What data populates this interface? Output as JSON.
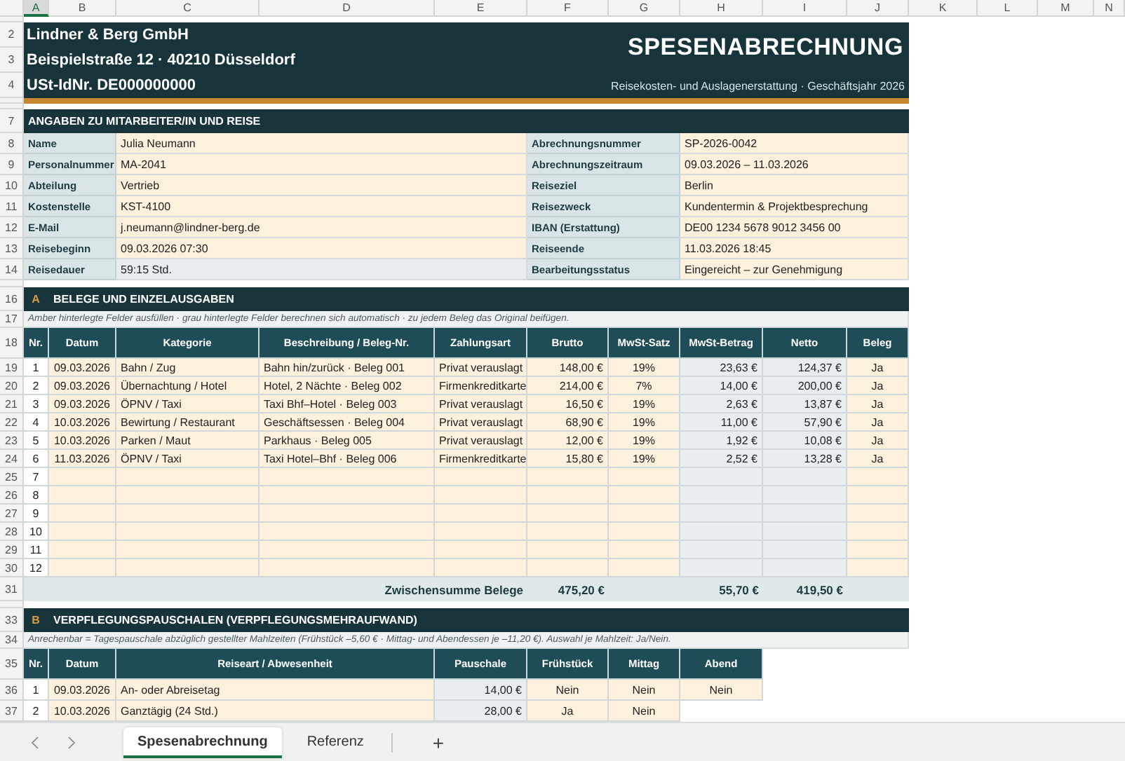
{
  "column_headers": [
    {
      "label": "A",
      "selected": true
    },
    {
      "label": "B",
      "selected": false
    },
    {
      "label": "C",
      "selected": false
    },
    {
      "label": "D",
      "selected": false
    },
    {
      "label": "E",
      "selected": false
    },
    {
      "label": "F",
      "selected": false
    },
    {
      "label": "G",
      "selected": false
    },
    {
      "label": "H",
      "selected": false
    },
    {
      "label": "I",
      "selected": false
    },
    {
      "label": "J",
      "selected": false
    },
    {
      "label": "K",
      "selected": false
    },
    {
      "label": "L",
      "selected": false
    },
    {
      "label": "M",
      "selected": false
    },
    {
      "label": "N",
      "selected": false
    }
  ],
  "row_numbers": [
    "2",
    "3",
    "4",
    "7",
    "8",
    "9",
    "10",
    "11",
    "12",
    "13",
    "14",
    "16",
    "17",
    "18",
    "19",
    "20",
    "21",
    "22",
    "23",
    "24",
    "25",
    "26",
    "27",
    "28",
    "29",
    "30",
    "31",
    "33",
    "34",
    "35",
    "36",
    "37"
  ],
  "header": {
    "company_lines": [
      "Lindner & Berg GmbH",
      "Beispielstraße 12 · 40210 Düsseldorf",
      "USt-IdNr. DE000000000"
    ],
    "title": "SPESENABRECHNUNG",
    "subtitle": "Reisekosten- und Auslagenerstattung  ·  Geschäftsjahr 2026"
  },
  "details": {
    "heading": "ANGABEN ZU MITARBEITER/IN UND REISE",
    "rows": [
      {
        "left": {
          "label": "Name",
          "value": "Julia Neumann",
          "kind": "input"
        },
        "right": {
          "label": "Abrechnungsnummer",
          "value": "SP-2026-0042",
          "kind": "input"
        }
      },
      {
        "left": {
          "label": "Personalnummer",
          "value": "MA-2041",
          "kind": "input"
        },
        "right": {
          "label": "Abrechnungszeitraum",
          "value": "09.03.2026 – 11.03.2026",
          "kind": "input"
        }
      },
      {
        "left": {
          "label": "Abteilung",
          "value": "Vertrieb",
          "kind": "input"
        },
        "right": {
          "label": "Reiseziel",
          "value": "Berlin",
          "kind": "input"
        }
      },
      {
        "left": {
          "label": "Kostenstelle",
          "value": "KST-4100",
          "kind": "input"
        },
        "right": {
          "label": "Reisezweck",
          "value": "Kundentermin & Projektbesprechung",
          "kind": "input"
        }
      },
      {
        "left": {
          "label": "E-Mail",
          "value": "j.neumann@lindner-berg.de",
          "kind": "input"
        },
        "right": {
          "label": "IBAN (Erstattung)",
          "value": "DE00 1234 5678 9012 3456 00",
          "kind": "input"
        }
      },
      {
        "left": {
          "label": "Reisebeginn",
          "value": "09.03.2026  07:30",
          "kind": "input"
        },
        "right": {
          "label": "Reiseende",
          "value": "11.03.2026  18:45",
          "kind": "input"
        }
      },
      {
        "left": {
          "label": "Reisedauer",
          "value": "59:15 Std.",
          "kind": "computed"
        },
        "right": {
          "label": "Bearbeitungsstatus",
          "value": "Eingereicht – zur Genehmigung",
          "kind": "input"
        }
      }
    ]
  },
  "receipts": {
    "letter": "A",
    "heading": "BELEGE UND EINZELAUSGABEN",
    "note": "Amber hinterlegte Felder ausfüllen · grau hinterlegte Felder berechnen sich automatisch · zu jedem Beleg das Original beifügen.",
    "columns": [
      {
        "label": "Nr.",
        "kind": "index"
      },
      {
        "label": "Datum",
        "kind": "input"
      },
      {
        "label": "Kategorie",
        "kind": "input"
      },
      {
        "label": "Beschreibung / Beleg-Nr.",
        "kind": "input"
      },
      {
        "label": "Zahlungsart",
        "kind": "input"
      },
      {
        "label": "Brutto",
        "kind": "input"
      },
      {
        "label": "MwSt-Satz",
        "kind": "input"
      },
      {
        "label": "MwSt-Betrag",
        "kind": "computed"
      },
      {
        "label": "Netto",
        "kind": "computed"
      },
      {
        "label": "Beleg",
        "kind": "input"
      }
    ],
    "rows": [
      {
        "cells": [
          "1",
          "09.03.2026",
          "Bahn / Zug",
          "Bahn hin/zurück · Beleg 001",
          "Privat verauslagt",
          "148,00 €",
          "19%",
          "23,63 €",
          "124,37 €",
          "Ja"
        ]
      },
      {
        "cells": [
          "2",
          "09.03.2026",
          "Übernachtung / Hotel",
          "Hotel, 2 Nächte · Beleg 002",
          "Firmenkreditkarte",
          "214,00 €",
          "7%",
          "14,00 €",
          "200,00 €",
          "Ja"
        ]
      },
      {
        "cells": [
          "3",
          "09.03.2026",
          "ÖPNV / Taxi",
          "Taxi Bhf–Hotel · Beleg 003",
          "Privat verauslagt",
          "16,50 €",
          "19%",
          "2,63 €",
          "13,87 €",
          "Ja"
        ]
      },
      {
        "cells": [
          "4",
          "10.03.2026",
          "Bewirtung / Restaurant",
          "Geschäftsessen · Beleg 004",
          "Privat verauslagt",
          "68,90 €",
          "19%",
          "11,00 €",
          "57,90 €",
          "Ja"
        ]
      },
      {
        "cells": [
          "5",
          "10.03.2026",
          "Parken / Maut",
          "Parkhaus · Beleg 005",
          "Privat verauslagt",
          "12,00 €",
          "19%",
          "1,92 €",
          "10,08 €",
          "Ja"
        ]
      },
      {
        "cells": [
          "6",
          "11.03.2026",
          "ÖPNV / Taxi",
          "Taxi Hotel–Bhf · Beleg 006",
          "Firmenkreditkarte",
          "15,80 €",
          "19%",
          "2,52 €",
          "13,28 €",
          "Ja"
        ]
      },
      {
        "cells": [
          "7"
        ]
      },
      {
        "cells": [
          "8"
        ]
      },
      {
        "cells": [
          "9"
        ]
      },
      {
        "cells": [
          "10"
        ]
      },
      {
        "cells": [
          "11"
        ]
      },
      {
        "cells": [
          "12"
        ]
      }
    ],
    "subtotal": {
      "label": "Zwischensumme Belege",
      "brutto": "475,20 €",
      "mwst_betrag": "55,70 €",
      "netto": "419,50 €"
    }
  },
  "meals": {
    "letter": "B",
    "heading": "VERPFLEGUNGSPAUSCHALEN  (VERPFLEGUNGSMEHRAUFWAND)",
    "note": "Anrechenbar = Tagespauschale abzüglich gestellter Mahlzeiten (Frühstück –5,60 € · Mittag- und Abendessen je –11,20 €). Auswahl je Mahlzeit: Ja/Nein.",
    "columns": [
      {
        "label": "Nr.",
        "kind": "index"
      },
      {
        "label": "Datum",
        "kind": "input"
      },
      {
        "label": "Reiseart / Abwesenheit",
        "kind": "input"
      },
      {
        "label": "Pauschale",
        "kind": "computed"
      },
      {
        "label": "Frühstück",
        "kind": "input"
      },
      {
        "label": "Mittag",
        "kind": "input"
      },
      {
        "label": "Abend",
        "kind": "input"
      }
    ],
    "rows": [
      {
        "cells": [
          "1",
          "09.03.2026",
          "An- oder Abreisetag",
          "14,00 €",
          "Nein",
          "Nein",
          "Nein"
        ]
      },
      {
        "cells": [
          "2",
          "10.03.2026",
          "Ganztägig (24 Std.)",
          "28,00 €",
          "Ja",
          "Nein"
        ]
      }
    ]
  },
  "sheet_tabs": [
    {
      "label": "Spesenabrechnung",
      "selected": true
    },
    {
      "label": "Referenz",
      "selected": false
    }
  ],
  "add_sheet": "+"
}
